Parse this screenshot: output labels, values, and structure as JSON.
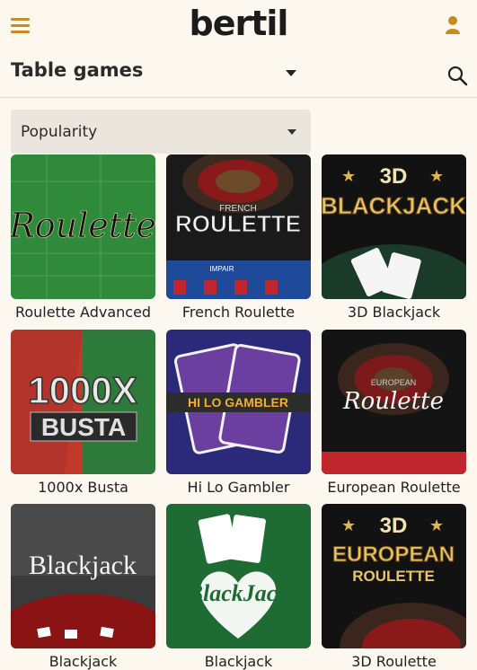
{
  "header": {
    "logo_text": "bertil",
    "menu_icon": "hamburger-menu-icon",
    "user_icon": "user-icon"
  },
  "category": {
    "title": "Table games",
    "dropdown_icon": "caret-down-icon",
    "search_icon": "search-icon"
  },
  "sort": {
    "selected": "Popularity",
    "icon": "caret-down-icon"
  },
  "games": [
    {
      "name": "Roulette Advanced",
      "thumb_text": "Roulette"
    },
    {
      "name": "French Roulette",
      "thumb_text": "ROULETTE",
      "thumb_sub": "FRENCH",
      "thumb_extra": "IMPAIR"
    },
    {
      "name": "3D Blackjack",
      "thumb_text": "BLACKJACK",
      "thumb_sub": "3D"
    },
    {
      "name": "1000x Busta",
      "thumb_text": "1000X",
      "thumb_sub": "BUSTA"
    },
    {
      "name": "Hi Lo Gambler",
      "thumb_text": "HI LO GAMBLER"
    },
    {
      "name": "European Roulette",
      "thumb_text": "Roulette",
      "thumb_sub": "EUROPEAN"
    },
    {
      "name": "Blackjack",
      "thumb_text": "Blackjack"
    },
    {
      "name": "Blackjack",
      "thumb_text": "BlackJack"
    },
    {
      "name": "3D Roulette",
      "thumb_text": "EUROPEAN",
      "thumb_sub": "3D",
      "thumb_extra": "ROULETTE"
    }
  ],
  "colors": {
    "background": "#fdf8ef",
    "accent": "#c98a1f",
    "select_bg": "#ebe6dd"
  }
}
